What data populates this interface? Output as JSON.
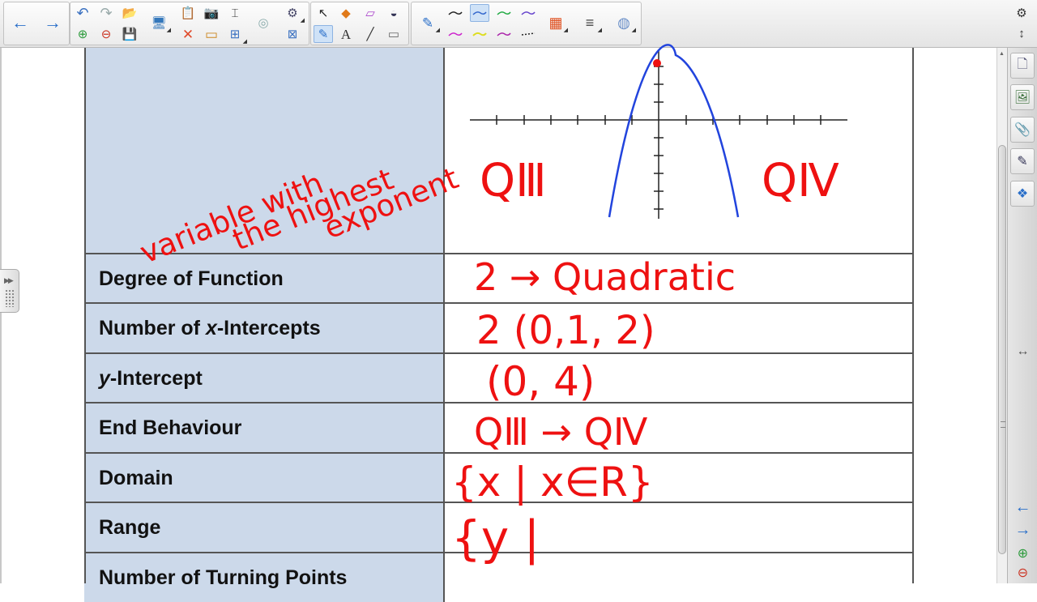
{
  "toolbar": {
    "groups": [
      {
        "name": "navigation",
        "buttons": [
          {
            "icon": "back-arrow-icon",
            "glyph": "←"
          },
          {
            "icon": "forward-arrow-icon",
            "glyph": "→"
          }
        ]
      },
      {
        "name": "page-actions",
        "buttons": [
          {
            "icon": "undo-icon",
            "glyph": "↶"
          },
          {
            "icon": "redo-icon",
            "glyph": "↷"
          },
          {
            "icon": "open-file-icon",
            "glyph": "📂"
          },
          {
            "icon": "add-page-icon",
            "glyph": "⊕"
          },
          {
            "icon": "delete-page-icon",
            "glyph": "⊖"
          },
          {
            "icon": "save-icon",
            "glyph": "💾"
          },
          {
            "icon": "display-icon",
            "glyph": "🖥"
          },
          {
            "icon": "paste-icon",
            "glyph": "📋"
          },
          {
            "icon": "delete-icon",
            "glyph": "✕"
          },
          {
            "icon": "screen-shade-icon",
            "glyph": "▭"
          },
          {
            "icon": "capture-icon",
            "glyph": "📷"
          },
          {
            "icon": "table-icon",
            "glyph": "▦"
          },
          {
            "icon": "insert-text-icon",
            "glyph": "⌶"
          },
          {
            "icon": "table-grid-icon",
            "glyph": "⊞"
          },
          {
            "icon": "doc-camera-icon",
            "glyph": "◎"
          },
          {
            "icon": "properties-icon",
            "glyph": "⚙"
          },
          {
            "icon": "close-box-icon",
            "glyph": "⊠"
          }
        ]
      },
      {
        "name": "tools",
        "buttons": [
          {
            "icon": "select-arrow-icon",
            "glyph": "↖"
          },
          {
            "icon": "shapes-icon",
            "glyph": "◆"
          },
          {
            "icon": "eraser-icon",
            "glyph": "▱"
          },
          {
            "icon": "fill-icon",
            "glyph": "◒"
          },
          {
            "icon": "pens-icon",
            "glyph": "✎"
          },
          {
            "icon": "text-icon",
            "glyph": "A"
          },
          {
            "icon": "line-icon",
            "glyph": "╱"
          },
          {
            "icon": "eraser-tool-icon",
            "glyph": "▭"
          }
        ]
      },
      {
        "name": "pen-styles",
        "colors": [
          "#222222",
          "#3366cc",
          "#22aa44",
          "#6644cc",
          "#cc22cc",
          "#dddd22",
          "#aa22aa",
          "#222222"
        ]
      },
      {
        "name": "misc",
        "buttons": [
          {
            "icon": "color-palette-icon",
            "glyph": "▦"
          },
          {
            "icon": "line-style-icon",
            "glyph": "≡"
          },
          {
            "icon": "fill-effects-icon",
            "glyph": "◍"
          }
        ]
      }
    ],
    "system": [
      {
        "icon": "gear-icon",
        "glyph": "⚙"
      },
      {
        "icon": "move-toolbar-icon",
        "glyph": "↕"
      }
    ]
  },
  "table": {
    "rows": [
      {
        "label": ""
      },
      {
        "label": "Degree of Function"
      },
      {
        "label_parts": [
          "Number of ",
          "x",
          "-Intercepts"
        ]
      },
      {
        "label_parts": [
          "y",
          "-Intercept"
        ]
      },
      {
        "label": "End Behaviour"
      },
      {
        "label": "Domain"
      },
      {
        "label": "Range"
      },
      {
        "label": "Number of Turning Points"
      }
    ]
  },
  "ink": {
    "annotation_lines": [
      "variable with",
      "the highest",
      "exponent"
    ],
    "quadrant_left": "QⅢ",
    "quadrant_right": "QⅣ",
    "degree": "2 → Quadratic",
    "x_intercepts": "2  (0,1, 2)",
    "y_intercept": "(0, 4)",
    "end_behaviour": "QⅢ → QⅣ",
    "domain": "{x | x∈R}",
    "range": "{y |",
    "ink_color": "#ee1111",
    "curve_color": "#2244dd"
  },
  "sidebar": {
    "tabs": [
      {
        "icon": "page-sorter-icon",
        "glyph": "🗋"
      },
      {
        "icon": "gallery-icon",
        "glyph": "🖼"
      },
      {
        "icon": "attachments-icon",
        "glyph": "📎"
      },
      {
        "icon": "properties-tab-icon",
        "glyph": "✎"
      },
      {
        "icon": "addons-icon",
        "glyph": "❖"
      }
    ],
    "resize_glyph": "↔",
    "bottom": [
      {
        "icon": "prev-page-icon",
        "glyph": "←"
      },
      {
        "icon": "next-page-icon",
        "glyph": "→"
      },
      {
        "icon": "add-page-side-icon",
        "glyph": "⊕"
      },
      {
        "icon": "delete-page-side-icon",
        "glyph": "⊖"
      }
    ]
  }
}
